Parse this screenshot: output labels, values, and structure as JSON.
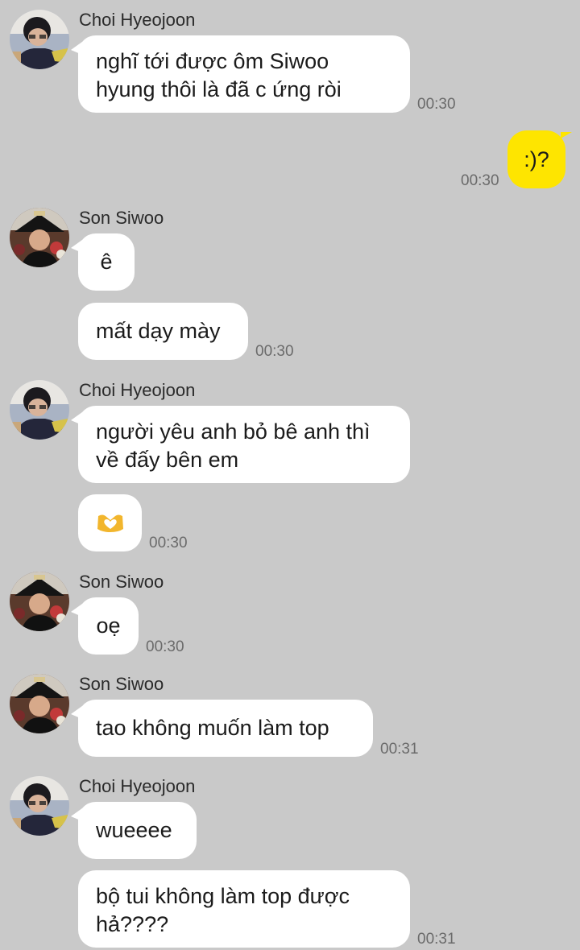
{
  "chat": {
    "m1": {
      "sender": "Choi Hyeojoon",
      "line1": "nghĩ tới được ôm Siwoo",
      "line2": "hyung thôi là đã c ứng ròi",
      "time": "00:30"
    },
    "m2": {
      "text": ":)?",
      "time": "00:30"
    },
    "m3": {
      "sender": "Son Siwoo",
      "text": "ê"
    },
    "m4": {
      "text": "mất dạy mày",
      "time": "00:30"
    },
    "m5": {
      "sender": "Choi Hyeojoon",
      "line1": "người yêu anh bỏ bê anh thì",
      "line2": "về đấy bên em"
    },
    "m6": {
      "emoji": "heart-hands-icon",
      "time": "00:30"
    },
    "m7": {
      "sender": "Son Siwoo",
      "text": "oẹ",
      "time": "00:30"
    },
    "m8": {
      "sender": "Son Siwoo",
      "text": "tao không muốn làm top",
      "time": "00:31"
    },
    "m9": {
      "sender": "Choi Hyeojoon",
      "text": "wueeee"
    },
    "m10": {
      "line1": "bộ tui không làm top được",
      "line2": "hả????",
      "time": "00:31"
    }
  },
  "colors": {
    "background": "#c9c9c9",
    "incoming_bubble": "#ffffff",
    "outgoing_bubble": "#fee500",
    "timestamp": "#6b6b6b"
  }
}
